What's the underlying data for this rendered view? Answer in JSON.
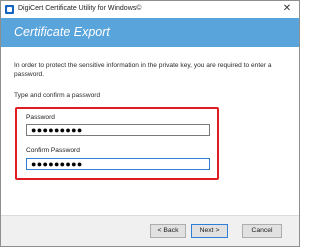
{
  "window": {
    "title": "DigiCert Certificate Utility for Windows©",
    "close_glyph": "✕"
  },
  "header": {
    "title": "Certificate Export"
  },
  "content": {
    "intro": "In order to protect the sensitive information in the private key, you are required to enter a password.",
    "type_label": "Type and confirm a password",
    "password": {
      "label": "Password",
      "value": "●●●●●●●●●"
    },
    "confirm_password": {
      "label": "Confirm Password",
      "value": "●●●●●●●●●"
    }
  },
  "footer": {
    "back_label": "< Back",
    "next_label": "Next >",
    "cancel_label": "Cancel"
  },
  "colors": {
    "header_bg": "#5aa4dc",
    "highlight": "#e01b22",
    "focus": "#2f7fd6"
  }
}
